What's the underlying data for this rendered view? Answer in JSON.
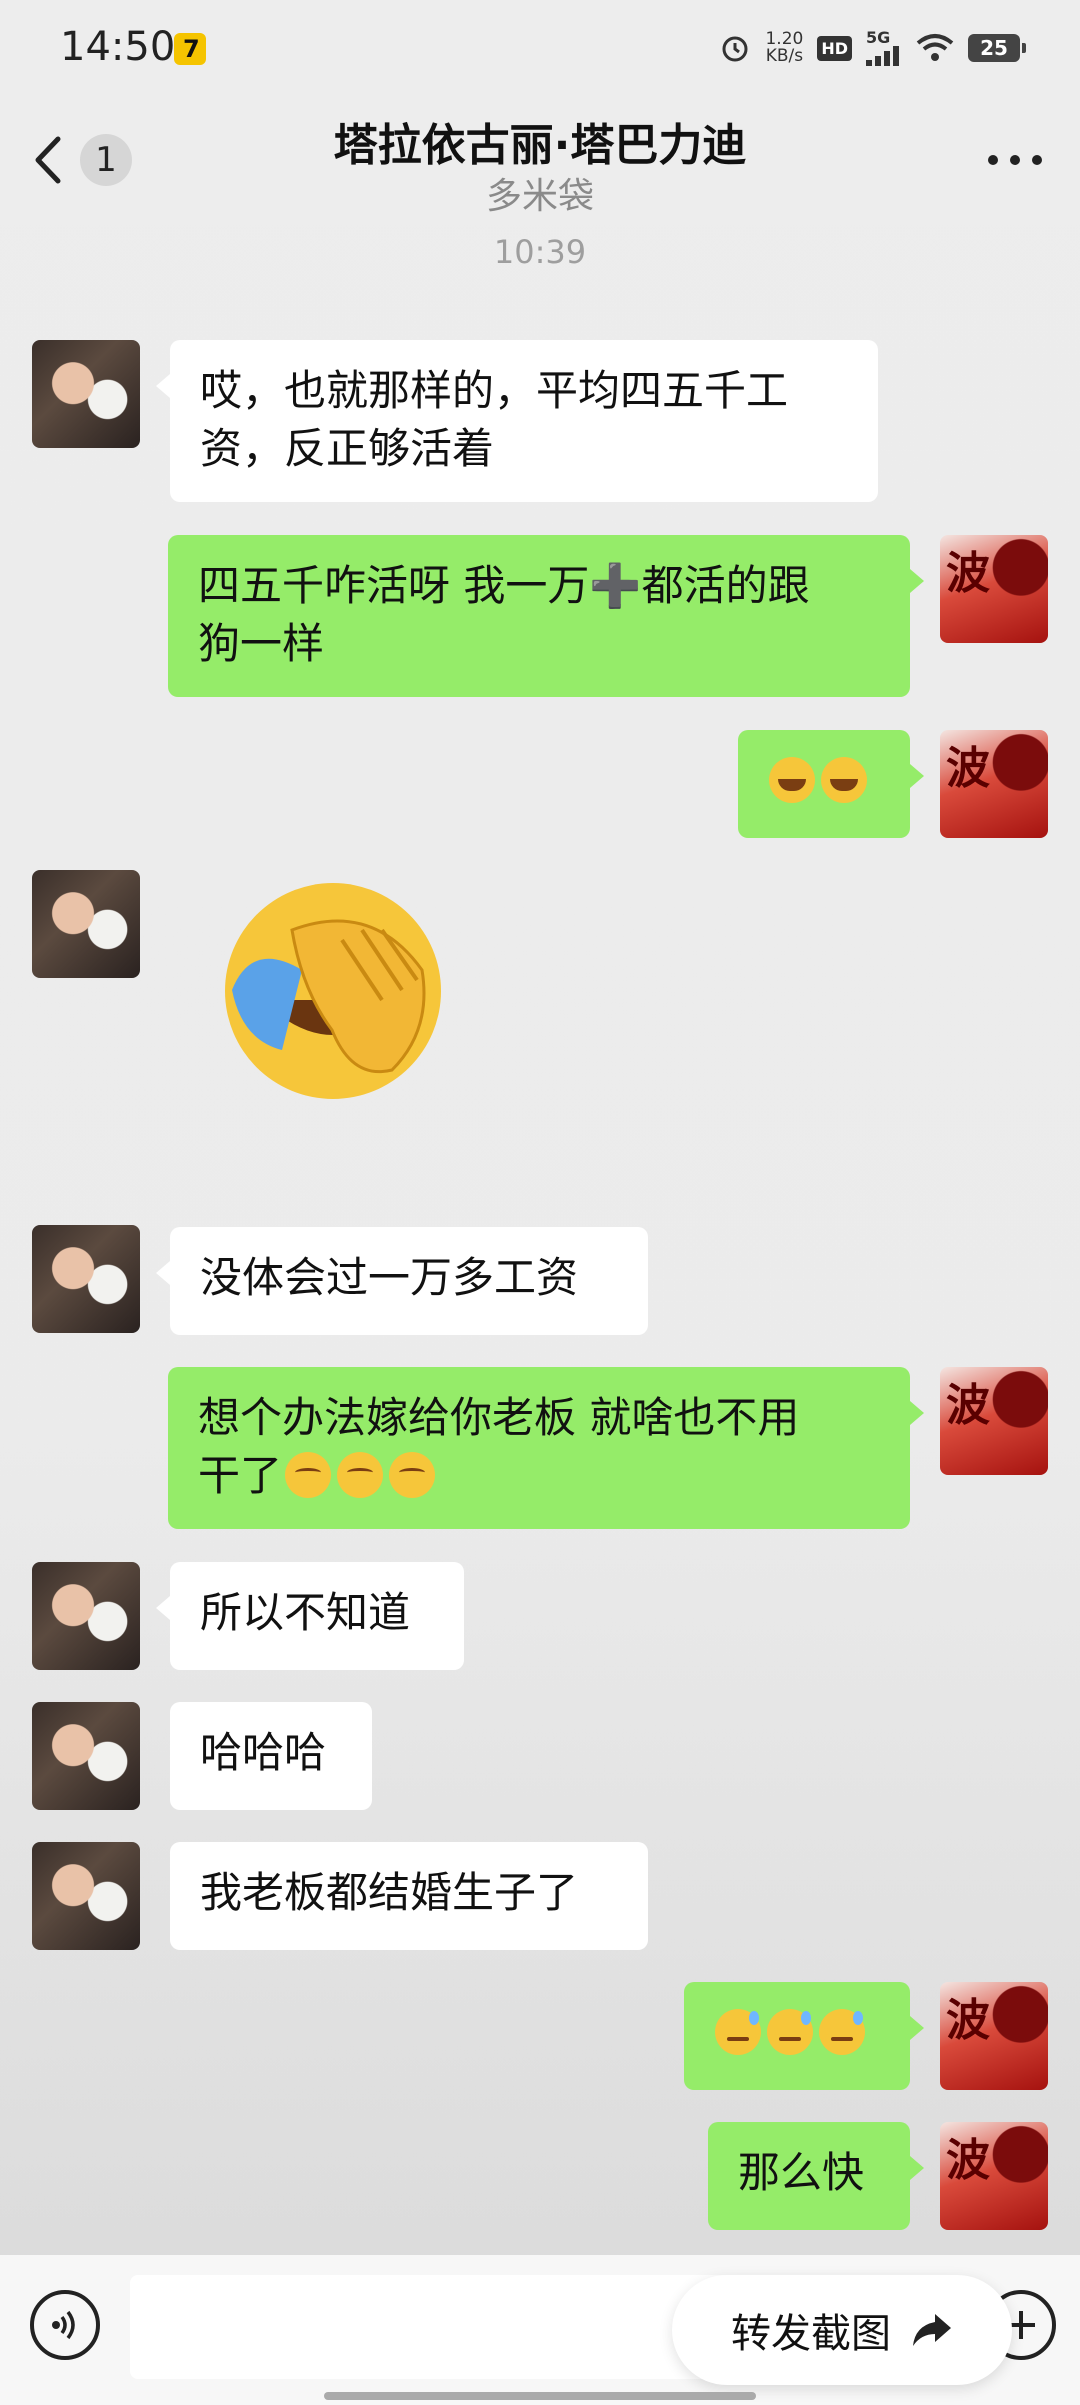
{
  "status_bar": {
    "time": "14:50",
    "app_badge": "7",
    "net_speed_value": "1.20",
    "net_speed_unit": "KB/s",
    "hd": "HD",
    "network": "5G",
    "battery": "25"
  },
  "header": {
    "unread_count": "1",
    "title": "塔拉依古丽·塔巴力迪",
    "subtitle": "多米袋"
  },
  "timestamp": "10:39",
  "avatar_right_char": "波",
  "messages": [
    {
      "from": "them",
      "line1": "哎，也就那样的，平均四五千工",
      "line2": "资，反正够活着"
    },
    {
      "from": "me",
      "line1": "四五千咋活呀 我一万➕都活的跟",
      "line2": "狗一样"
    },
    {
      "from": "me",
      "emoji": [
        "laugh",
        "laugh"
      ]
    },
    {
      "from": "them",
      "sticker": "facepalm-sticker"
    },
    {
      "from": "them",
      "text": "没体会过一万多工资"
    },
    {
      "from": "me",
      "line1": "想个办法嫁给你老板 就啥也不用",
      "line2": "干了",
      "emoji": [
        "shy",
        "shy",
        "shy"
      ]
    },
    {
      "from": "them",
      "text": "所以不知道"
    },
    {
      "from": "them",
      "text": "哈哈哈"
    },
    {
      "from": "them",
      "text": "我老板都结婚生子了"
    },
    {
      "from": "me",
      "emoji": [
        "sweat",
        "sweat",
        "sweat"
      ]
    },
    {
      "from": "me",
      "text": "那么快"
    }
  ],
  "bottom_bar": {
    "forward_label": "转发截图"
  },
  "colors": {
    "bubble_out": "#95ec69",
    "bubble_in": "#ffffff",
    "background": "#ededed"
  }
}
